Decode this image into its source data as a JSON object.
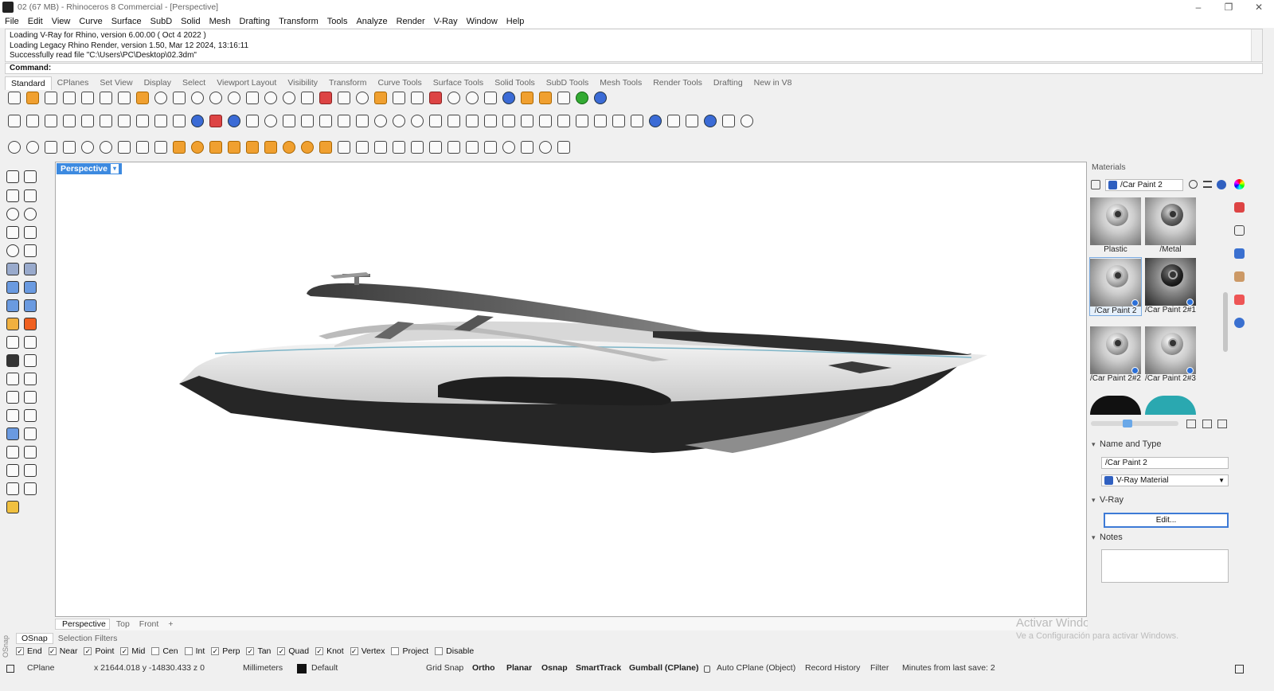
{
  "window": {
    "title": "02 (67 MB) - Rhinoceros 8 Commercial - [Perspective]"
  },
  "menu": [
    "File",
    "Edit",
    "View",
    "Curve",
    "Surface",
    "SubD",
    "Solid",
    "Mesh",
    "Drafting",
    "Transform",
    "Tools",
    "Analyze",
    "Render",
    "V-Ray",
    "Window",
    "Help"
  ],
  "history": [
    "Loading V-Ray for Rhino, version 6.00.00 ( Oct  4 2022 )",
    "Loading Legacy Rhino Render, version 1.50, Mar 12 2024, 13:16:11",
    "Successfully read file \"C:\\Users\\PC\\Desktop\\02.3dm\""
  ],
  "command": {
    "label": "Command:"
  },
  "toolbar_tabs": [
    "Standard",
    "CPlanes",
    "Set View",
    "Display",
    "Select",
    "Viewport Layout",
    "Visibility",
    "Transform",
    "Curve Tools",
    "Surface Tools",
    "Solid Tools",
    "SubD Tools",
    "Mesh Tools",
    "Render Tools",
    "Drafting",
    "New in V8"
  ],
  "viewport": {
    "label": "Perspective",
    "dropdown": "▾"
  },
  "viewport_tabs": [
    "Perspective",
    "Top",
    "Front",
    "+"
  ],
  "materials": {
    "panel_title": "Materials",
    "current": "/Car Paint 2",
    "thumbnails": [
      {
        "label": "Plastic"
      },
      {
        "label": "/Metal"
      },
      {
        "label": "/Car Paint 2"
      },
      {
        "label": "/Car Paint 2#1"
      },
      {
        "label": "/Car Paint 2#2"
      },
      {
        "label": "/Car Paint 2#3"
      }
    ],
    "name_and_type": "Name and Type",
    "name": "/Car Paint 2",
    "type": "V-Ray Material",
    "vray_section": "V-Ray",
    "edit_button": "Edit...",
    "notes_section": "Notes"
  },
  "watermark": {
    "line1": "Activar Windows",
    "line2": "Ve a Configuración para activar Windows."
  },
  "osnap_tabs": [
    "OSnap",
    "Selection Filters"
  ],
  "osnap": [
    {
      "label": "End",
      "checked": true
    },
    {
      "label": "Near",
      "checked": true
    },
    {
      "label": "Point",
      "checked": true
    },
    {
      "label": "Mid",
      "checked": true
    },
    {
      "label": "Cen",
      "checked": false
    },
    {
      "label": "Int",
      "checked": false
    },
    {
      "label": "Perp",
      "checked": true
    },
    {
      "label": "Tan",
      "checked": true
    },
    {
      "label": "Quad",
      "checked": true
    },
    {
      "label": "Knot",
      "checked": true
    },
    {
      "label": "Vertex",
      "checked": true
    },
    {
      "label": "Project",
      "checked": false
    },
    {
      "label": "Disable",
      "checked": false
    }
  ],
  "status": {
    "cplane": "CPlane",
    "coords": "x 21644.018   y -14830.433   z 0",
    "units": "Millimeters",
    "layer": "Default",
    "grid_snap": "Grid Snap",
    "ortho": "Ortho",
    "planar": "Planar",
    "osnap": "Osnap",
    "smarttrack": "SmartTrack",
    "gumball": "Gumball (CPlane)",
    "auto_cplane": "Auto CPlane (Object)",
    "record_history": "Record History",
    "filter": "Filter",
    "minutes": "Minutes from last save: 2"
  },
  "colors": {
    "accent": "#3d8ae0",
    "hull_dark": "#2a2a2a",
    "hull_light": "#e2e2e2"
  }
}
